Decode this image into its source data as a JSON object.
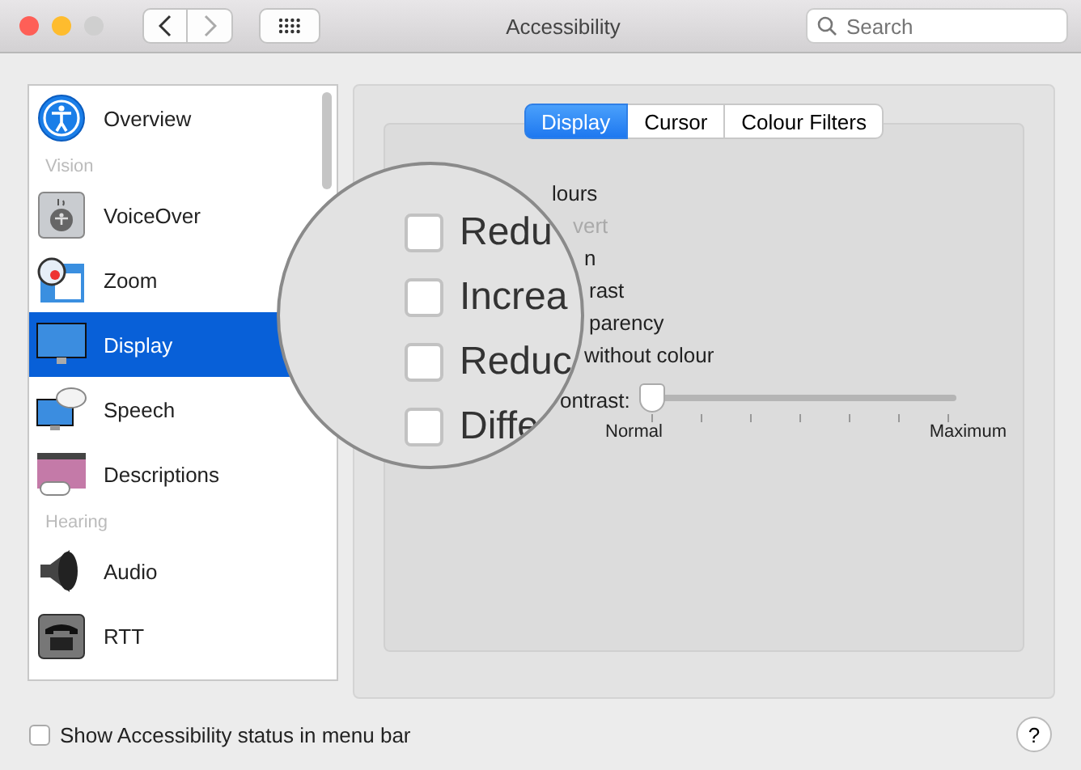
{
  "window": {
    "title": "Accessibility"
  },
  "search": {
    "placeholder": "Search"
  },
  "sidebar": {
    "items": [
      {
        "kind": "item",
        "label": "Overview",
        "selected": false
      },
      {
        "kind": "header",
        "label": "Vision"
      },
      {
        "kind": "item",
        "label": "VoiceOver",
        "selected": false
      },
      {
        "kind": "item",
        "label": "Zoom",
        "selected": false
      },
      {
        "kind": "item",
        "label": "Display",
        "selected": true
      },
      {
        "kind": "item",
        "label": "Speech",
        "selected": false
      },
      {
        "kind": "item",
        "label": "Descriptions",
        "selected": false
      },
      {
        "kind": "header",
        "label": "Hearing"
      },
      {
        "kind": "item",
        "label": "Audio",
        "selected": false
      },
      {
        "kind": "item",
        "label": "RTT",
        "selected": false
      }
    ]
  },
  "tabs": [
    {
      "label": "Display",
      "selected": true
    },
    {
      "label": "Cursor",
      "selected": false
    },
    {
      "label": "Colour Filters",
      "selected": false
    }
  ],
  "options": [
    {
      "text": "lours",
      "disabled": false
    },
    {
      "text": "vert",
      "disabled": true
    },
    {
      "text": "n",
      "disabled": false
    },
    {
      "text": "rast",
      "disabled": false
    },
    {
      "text": "parency",
      "disabled": false
    },
    {
      "text": "without colour",
      "disabled": false
    }
  ],
  "contrast": {
    "label": "ontrast:",
    "level": 0,
    "min_label": "Normal",
    "max_label": "Maximum"
  },
  "magnifier": {
    "items": [
      {
        "text": "Redu",
        "checked": false
      },
      {
        "text": "Increa",
        "checked": false
      },
      {
        "text": "Reduc",
        "checked": false
      },
      {
        "text": "Diffe",
        "checked": false
      }
    ]
  },
  "footer": {
    "checkbox": {
      "label": "Show Accessibility status in menu bar",
      "checked": false
    },
    "help": "?"
  }
}
